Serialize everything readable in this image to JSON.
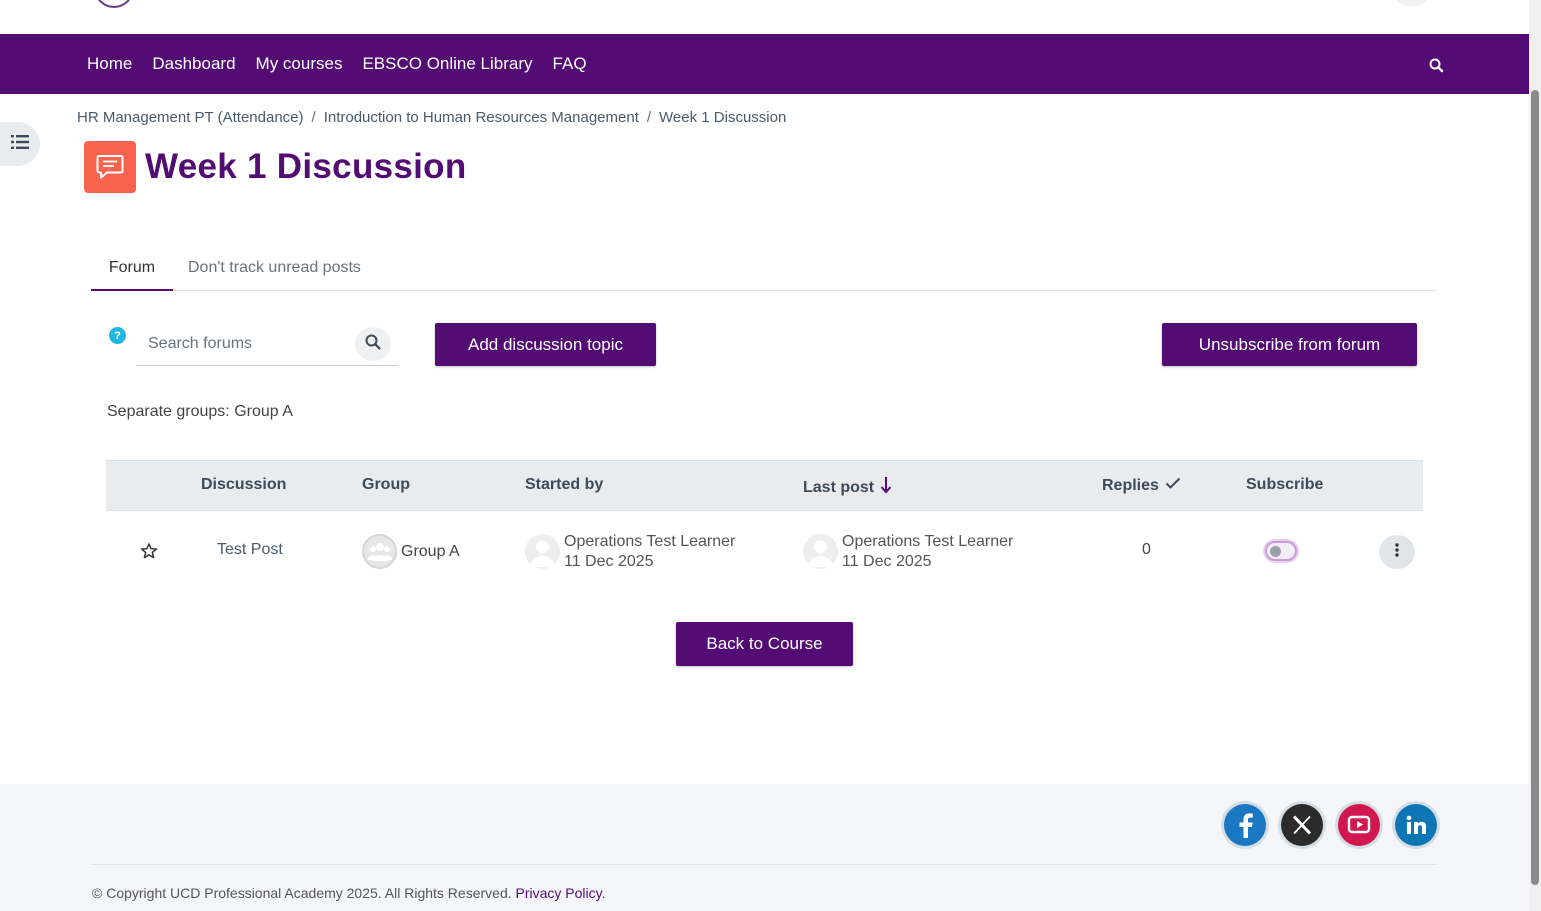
{
  "nav": {
    "items": [
      {
        "label": "Home"
      },
      {
        "label": "Dashboard"
      },
      {
        "label": "My courses"
      },
      {
        "label": "EBSCO Online Library"
      },
      {
        "label": "FAQ"
      }
    ],
    "search_icon": "search-icon"
  },
  "breadcrumb": {
    "items": [
      {
        "label": "HR Management PT (Attendance)"
      },
      {
        "label": "Introduction to Human Resources Management"
      },
      {
        "label": "Week 1 Discussion"
      }
    ],
    "separator": "/"
  },
  "page": {
    "title": "Week 1 Discussion",
    "icon": "forum-icon",
    "icon_color": "#f7634d"
  },
  "tabs": [
    {
      "label": "Forum",
      "active": true
    },
    {
      "label": "Don't track unread posts",
      "active": false
    }
  ],
  "toolbar": {
    "help": "?",
    "search_placeholder": "Search forums",
    "add_label": "Add discussion topic",
    "unsubscribe_label": "Unsubscribe from forum"
  },
  "groups_mode": "Separate groups: Group A",
  "table": {
    "headers": {
      "discussion": "Discussion",
      "group": "Group",
      "started_by": "Started by",
      "last_post": "Last post",
      "replies": "Replies",
      "subscribe": "Subscribe"
    },
    "rows": [
      {
        "topic": "Test Post",
        "group": "Group A",
        "started_by_name": "Operations Test Learner",
        "started_by_date": "11 Dec 2025",
        "last_post_name": "Operations Test Learner",
        "last_post_date": "11 Dec 2025",
        "replies": "0",
        "subscribed": false
      }
    ]
  },
  "back_label": "Back to Course",
  "footer": {
    "copyright": "© Copyright UCD Professional Academy 2025. All Rights Reserved.",
    "privacy_label": "Privacy Policy",
    "period": ".",
    "social": [
      "facebook-icon",
      "x-icon",
      "youtube-icon",
      "linkedin-icon"
    ]
  },
  "colors": {
    "brand": "#520c73",
    "accent_help": "#1fb6e0"
  }
}
